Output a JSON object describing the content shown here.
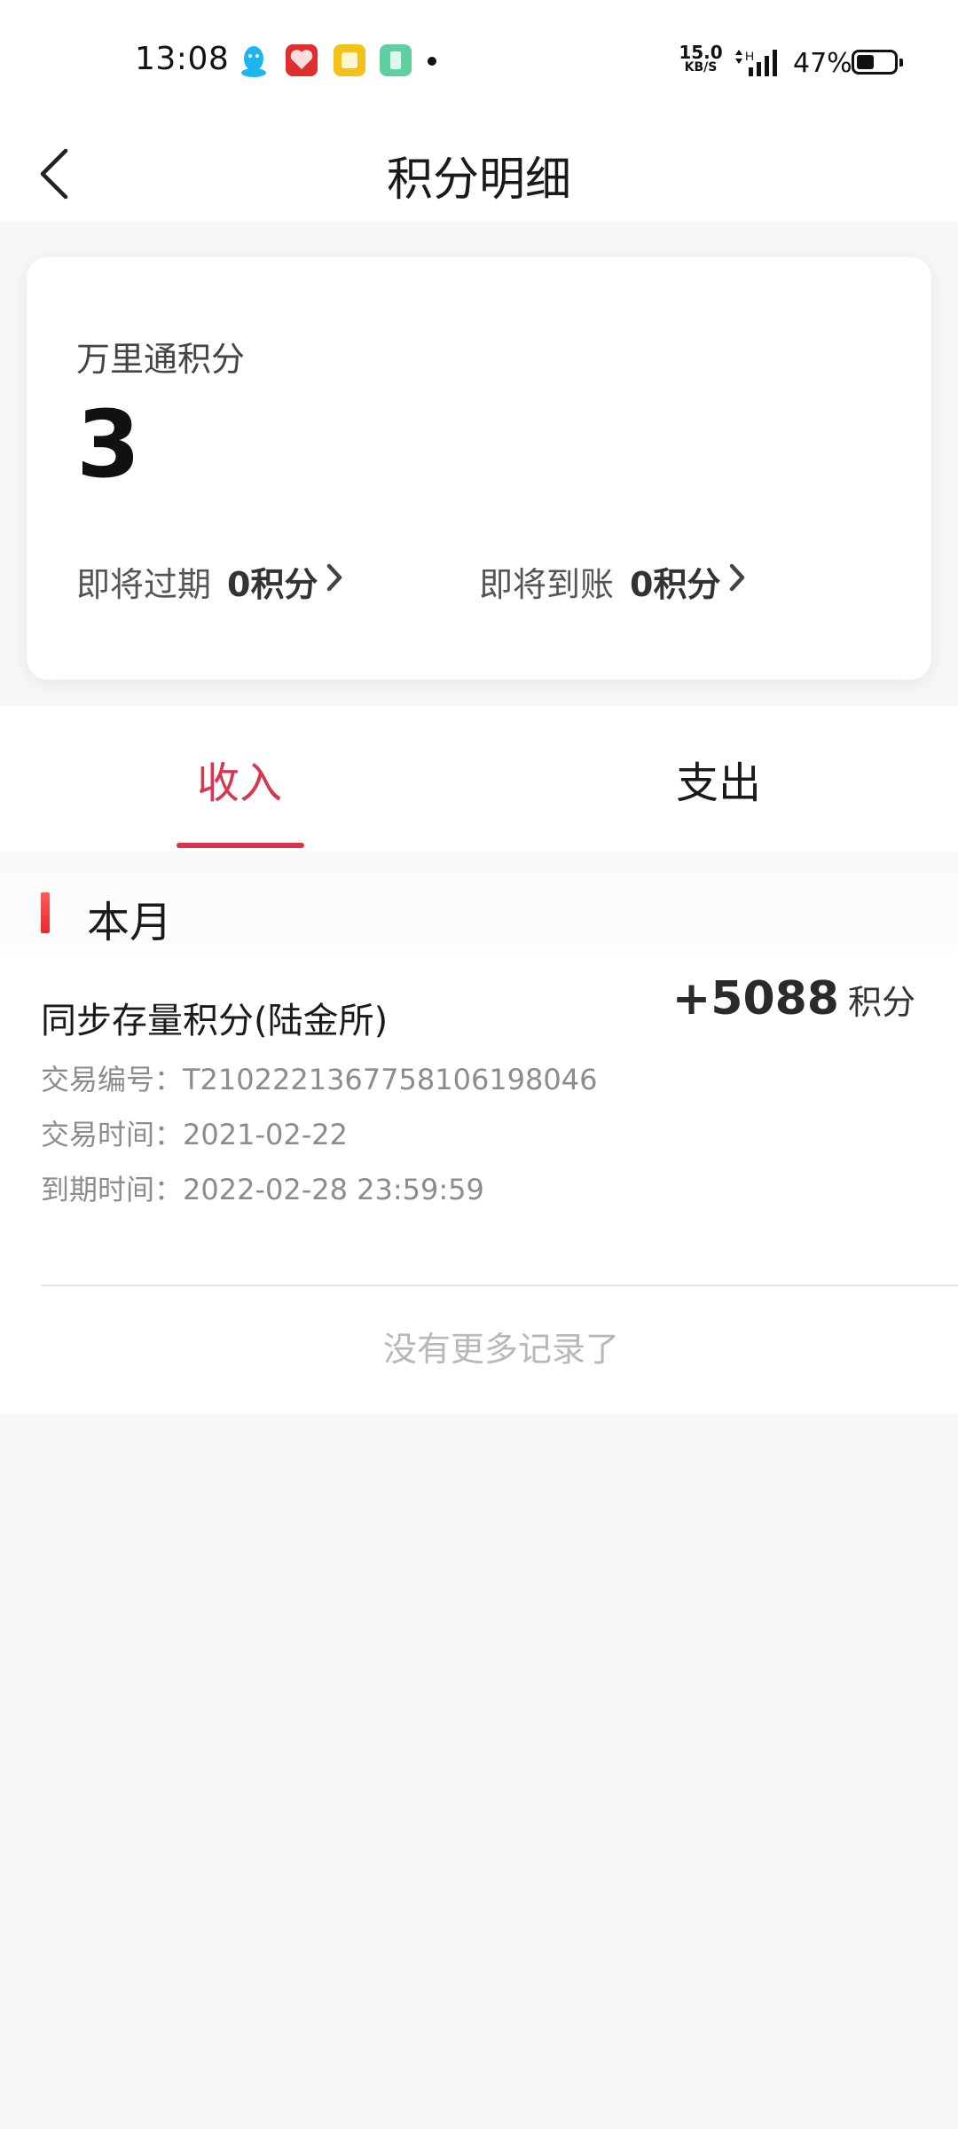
{
  "status_bar": {
    "time": "13:08",
    "net_speed": "15.0",
    "net_unit": "KB/S",
    "battery_pct": "47%",
    "battery_level": 0.47,
    "icons": [
      "qq-icon",
      "lottery-app-icon",
      "notes-app-icon",
      "green-app-icon",
      "notification-dot",
      "signal-icon",
      "battery-icon"
    ]
  },
  "nav": {
    "title": "积分明细"
  },
  "card": {
    "label": "万里通积分",
    "value": "3",
    "expire": {
      "label": "即将过期",
      "amount": "0积分"
    },
    "arrive": {
      "label": "即将到账",
      "amount": "0积分"
    }
  },
  "tabs": [
    {
      "label": "收入",
      "active": true
    },
    {
      "label": "支出",
      "active": false
    }
  ],
  "colors": {
    "accent": "#d8354f",
    "month_marker": "#e82a2a"
  },
  "list": {
    "month_label": "本月",
    "records": [
      {
        "title": "同步存量积分(陆金所)",
        "amount": "+5088",
        "unit": "积分",
        "trade_no": "交易编号：T2102221367758106198046",
        "trade_time": "交易时间：2021-02-22",
        "expire_time": "到期时间：2022-02-28 23:59:59"
      }
    ],
    "no_more": "没有更多记录了"
  }
}
